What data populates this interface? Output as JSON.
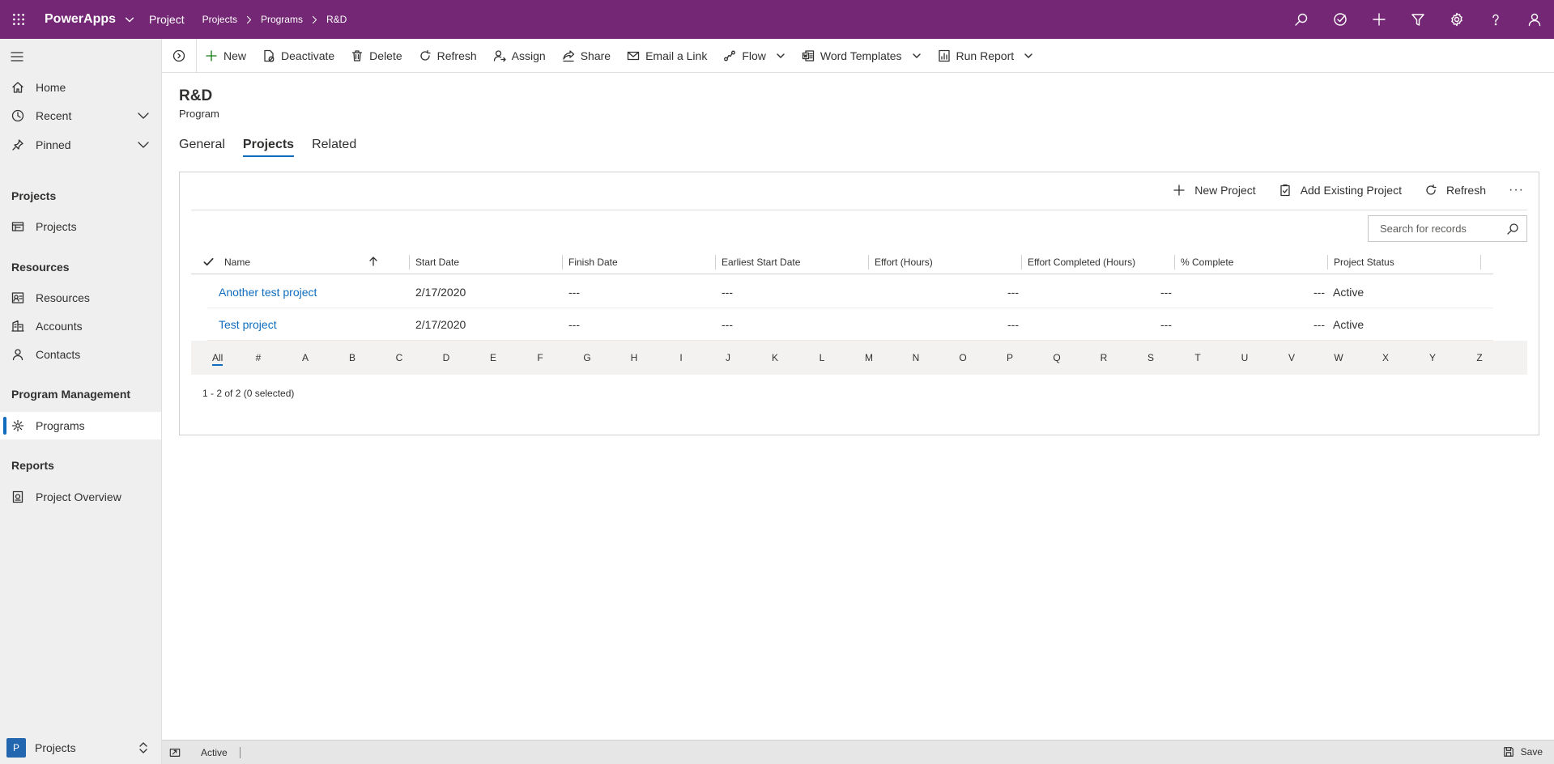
{
  "topbar": {
    "app_name": "PowerApps",
    "module": "Project",
    "breadcrumb": [
      "Projects",
      "Programs",
      "R&D"
    ],
    "brand_color": "#742774"
  },
  "sidenav": {
    "items": {
      "home": "Home",
      "recent": "Recent",
      "pinned": "Pinned"
    },
    "groups": {
      "projects": {
        "title": "Projects",
        "items": [
          "Projects"
        ]
      },
      "resources": {
        "title": "Resources",
        "items": [
          "Resources",
          "Accounts",
          "Contacts"
        ]
      },
      "program_management": {
        "title": "Program Management",
        "items": [
          "Programs"
        ]
      },
      "reports": {
        "title": "Reports",
        "items": [
          "Project Overview"
        ]
      }
    },
    "area": {
      "badge": "P",
      "label": "Projects"
    }
  },
  "commands": {
    "new": "New",
    "deactivate": "Deactivate",
    "delete": "Delete",
    "refresh": "Refresh",
    "assign": "Assign",
    "share": "Share",
    "email_link": "Email a Link",
    "flow": "Flow",
    "word_templates": "Word Templates",
    "run_report": "Run Report"
  },
  "record": {
    "title": "R&D",
    "entity": "Program"
  },
  "tabs": [
    "General",
    "Projects",
    "Related"
  ],
  "subgrid": {
    "commands": {
      "new_project": "New Project",
      "add_existing": "Add Existing Project",
      "refresh": "Refresh",
      "more": "···"
    },
    "search_placeholder": "Search for records",
    "columns": [
      "Name",
      "Start Date",
      "Finish Date",
      "Earliest Start Date",
      "Effort (Hours)",
      "Effort Completed (Hours)",
      "% Complete",
      "Project Status"
    ],
    "rows": [
      {
        "name": "Another test project",
        "start": "2/17/2020",
        "finish": "---",
        "earliest": "---",
        "effort": "---",
        "effort_completed": "---",
        "complete": "---",
        "status": "Active"
      },
      {
        "name": "Test project",
        "start": "2/17/2020",
        "finish": "---",
        "earliest": "---",
        "effort": "---",
        "effort_completed": "---",
        "complete": "---",
        "status": "Active"
      }
    ],
    "jump_letters": [
      "All",
      "#",
      "A",
      "B",
      "C",
      "D",
      "E",
      "F",
      "G",
      "H",
      "I",
      "J",
      "K",
      "L",
      "M",
      "N",
      "O",
      "P",
      "Q",
      "R",
      "S",
      "T",
      "U",
      "V",
      "W",
      "X",
      "Y",
      "Z"
    ],
    "pager": "1 - 2 of 2 (0 selected)"
  },
  "footer": {
    "status": "Active",
    "save": "Save"
  },
  "icons": [
    "waffle-icon",
    "chevron-down-icon",
    "chevron-right-icon",
    "search-icon",
    "task-check-icon",
    "plus-icon",
    "filter-icon",
    "gear-icon",
    "help-icon",
    "person-icon",
    "hamburger-icon",
    "home-icon",
    "clock-icon",
    "pin-icon",
    "board-icon",
    "resources-icon",
    "accounts-icon",
    "contact-icon",
    "program-icon",
    "report-icon",
    "delete-icon",
    "refresh-icon",
    "share-icon",
    "mail-icon",
    "flow-icon",
    "word-icon",
    "save-icon"
  ]
}
